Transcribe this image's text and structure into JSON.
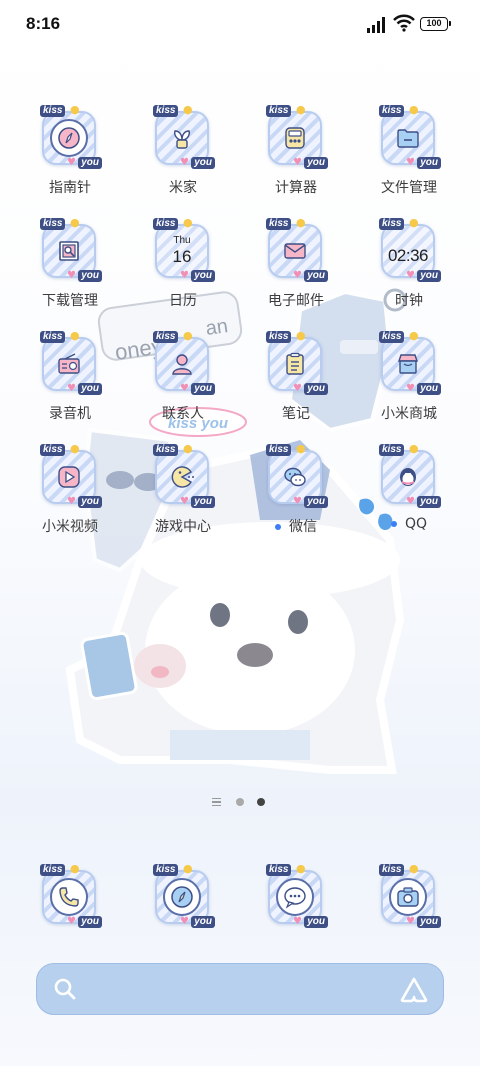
{
  "status_bar": {
    "time": "8:16",
    "battery": "100"
  },
  "apps": [
    {
      "label": "指南针",
      "icon": "compass-icon"
    },
    {
      "label": "米家",
      "icon": "mi-home-icon"
    },
    {
      "label": "计算器",
      "icon": "calculator-icon"
    },
    {
      "label": "文件管理",
      "icon": "folder-icon"
    },
    {
      "label": "下载管理",
      "icon": "download-icon"
    },
    {
      "label": "日历",
      "icon": "calendar-icon",
      "day": "Thu",
      "date": "16"
    },
    {
      "label": "电子邮件",
      "icon": "mail-icon"
    },
    {
      "label": "时钟",
      "icon": "clock-icon",
      "time": "02:36"
    },
    {
      "label": "录音机",
      "icon": "radio-icon"
    },
    {
      "label": "联系人",
      "icon": "contact-icon"
    },
    {
      "label": "笔记",
      "icon": "notes-icon"
    },
    {
      "label": "小米商城",
      "icon": "store-icon"
    },
    {
      "label": "小米视频",
      "icon": "video-play-icon"
    },
    {
      "label": "游戏中心",
      "icon": "pacman-icon"
    },
    {
      "label": "微信",
      "icon": "wechat-icon",
      "new_dot": true
    },
    {
      "label": "QQ",
      "icon": "penguin-icon",
      "new_dot": true
    }
  ],
  "dock": [
    {
      "icon": "phone-icon"
    },
    {
      "icon": "browser-icon"
    },
    {
      "icon": "messages-icon"
    },
    {
      "icon": "camera-icon"
    }
  ],
  "icon_badge": {
    "top": "kiss",
    "bottom": "you"
  },
  "wallpaper": {
    "sticker_text": "kiss you",
    "bottle_text": "oney",
    "bottle_text_right": "an"
  },
  "colors": {
    "search_bar": "#b7d0ee",
    "icon_stripe": "#c9d8f5",
    "badge_bg": "#3e4f86",
    "accent_pink": "#f28fb5",
    "notification_dot": "#3c7ef5"
  },
  "pager": {
    "pages": 3,
    "current": 3
  }
}
